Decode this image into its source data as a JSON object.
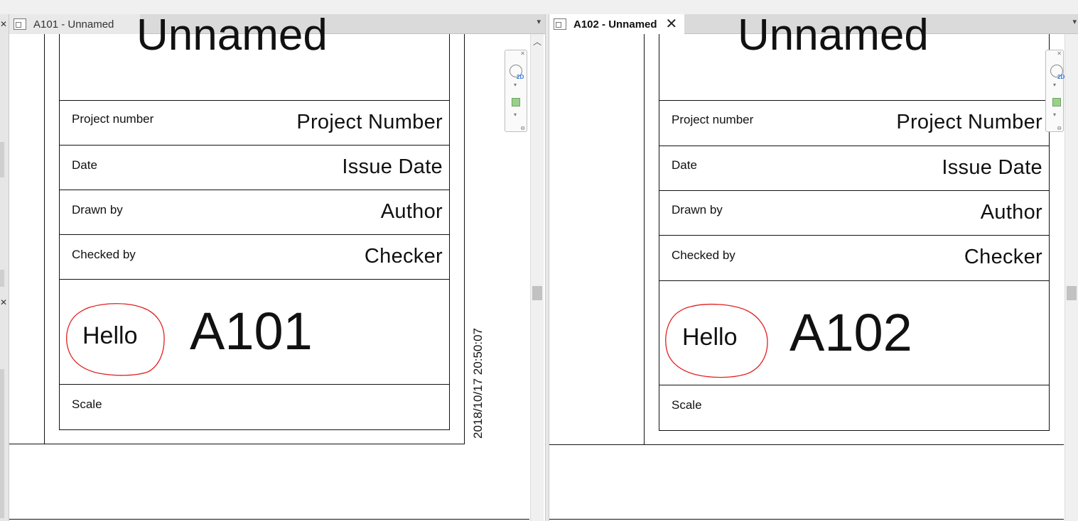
{
  "views": [
    {
      "tab_title": "A101 - Unnamed",
      "sheet_name": "Unnamed",
      "rows": [
        {
          "label": "Project number",
          "value": "Project  Number"
        },
        {
          "label": "Date",
          "value": "Issue Date"
        },
        {
          "label": "Drawn by",
          "value": "Author"
        },
        {
          "label": "Checked by",
          "value": "Checker"
        }
      ],
      "sheet_number": "A101",
      "cloud_text": "Hello",
      "scale_label": "Scale",
      "timestamp": "2018/10/17 20:50:07"
    },
    {
      "tab_title": "A102 - Unnamed",
      "sheet_name": "Unnamed",
      "rows": [
        {
          "label": "Project number",
          "value": "Project  Number"
        },
        {
          "label": "Date",
          "value": "Issue Date"
        },
        {
          "label": "Drawn by",
          "value": "Author"
        },
        {
          "label": "Checked by",
          "value": "Checker"
        }
      ],
      "sheet_number": "A102",
      "cloud_text": "Hello",
      "scale_label": "Scale"
    }
  ],
  "icons": {
    "tab": "sheet-view-icon",
    "close": "close-icon",
    "dropdown": "chevron-down-icon",
    "scroll_up": "chevron-up-icon",
    "steering": "steering-wheel-icon",
    "zoom": "zoom-icon"
  },
  "glyphs": {
    "close": "✕",
    "dropdown": "▾",
    "scroll_up": "︿",
    "nav_2d": "2D"
  },
  "colors": {
    "revision_cloud": "#e02020",
    "active_tab": "#ffffff",
    "inactive_tab": "#e9e9e9"
  }
}
